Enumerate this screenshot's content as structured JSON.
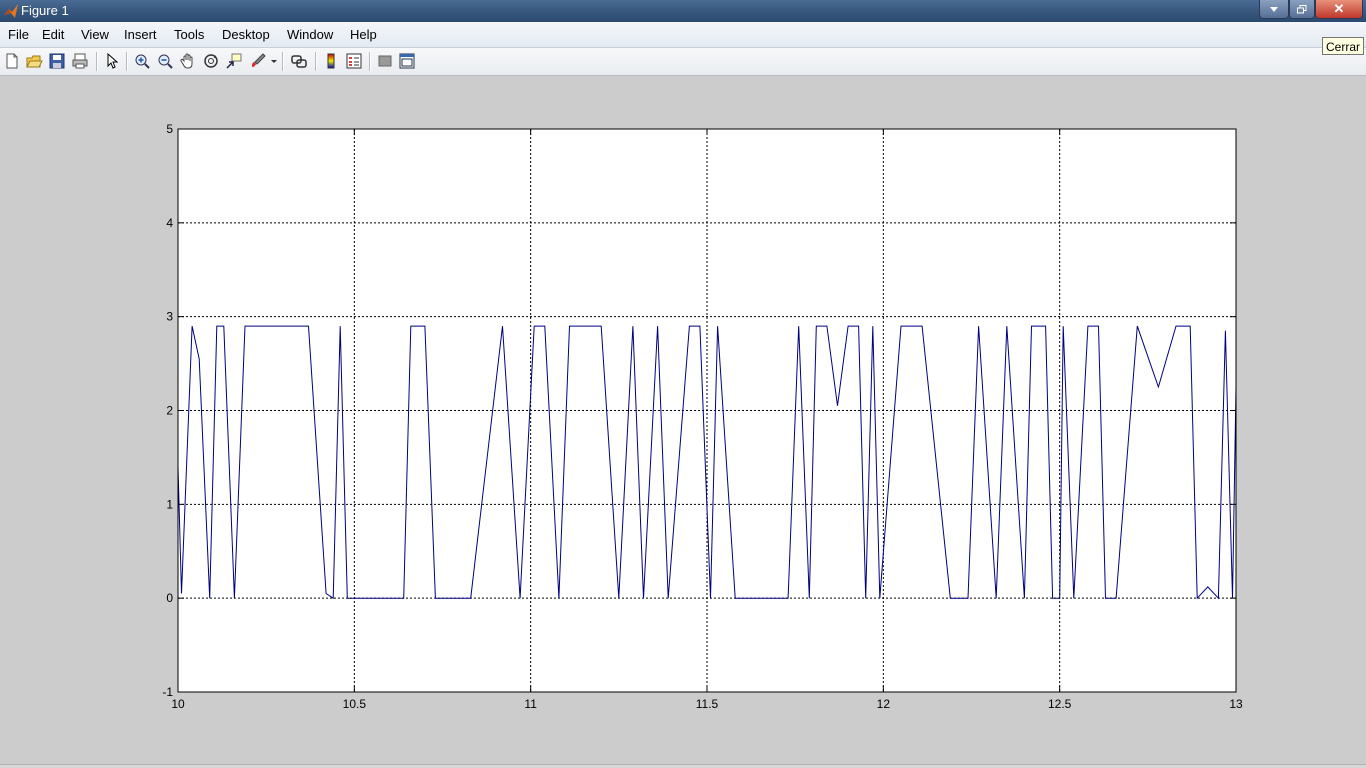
{
  "window": {
    "title": "Figure 1",
    "close_tooltip": "Cerrar"
  },
  "menu": [
    "File",
    "Edit",
    "View",
    "Insert",
    "Tools",
    "Desktop",
    "Window",
    "Help"
  ],
  "toolbar": [
    {
      "name": "new-figure-icon"
    },
    {
      "name": "open-file-icon"
    },
    {
      "name": "save-icon"
    },
    {
      "name": "print-icon"
    },
    {
      "name": "edit-plot-arrow-icon"
    },
    {
      "name": "zoom-in-icon"
    },
    {
      "name": "zoom-out-icon"
    },
    {
      "name": "pan-hand-icon"
    },
    {
      "name": "rotate-3d-icon"
    },
    {
      "name": "data-cursor-icon"
    },
    {
      "name": "brush-icon"
    },
    {
      "name": "link-plot-icon"
    },
    {
      "name": "insert-colorbar-icon"
    },
    {
      "name": "insert-legend-icon"
    },
    {
      "name": "hide-plot-tools-icon"
    },
    {
      "name": "show-plot-tools-icon"
    }
  ],
  "colors": {
    "line": "#000080",
    "grid": "#000000",
    "axes_bg": "#ffffff",
    "figure_bg": "#cccccc"
  },
  "chart_data": {
    "type": "line",
    "xlim": [
      10,
      13
    ],
    "ylim": [
      -1,
      5
    ],
    "xticks": [
      "10",
      "10.5",
      "11",
      "11.5",
      "12",
      "12.5",
      "13"
    ],
    "yticks": [
      "-1",
      "0",
      "1",
      "2",
      "3",
      "4",
      "5"
    ],
    "grid": true,
    "series": [
      {
        "x": [
          10.0,
          10.01,
          10.04,
          10.06,
          10.09,
          10.11,
          10.13,
          10.16,
          10.19,
          10.24,
          10.3,
          10.37,
          10.42,
          10.44,
          10.46,
          10.48,
          10.5,
          10.64,
          10.66,
          10.7,
          10.73,
          10.83,
          10.92,
          10.97,
          11.01,
          11.04,
          11.08,
          11.11,
          11.2,
          11.25,
          11.29,
          11.32,
          11.36,
          11.39,
          11.45,
          11.48,
          11.51,
          11.53,
          11.58,
          11.73,
          11.76,
          11.79,
          11.81,
          11.84,
          11.87,
          11.9,
          11.93,
          11.95,
          11.97,
          11.99,
          12.05,
          12.07,
          12.11,
          12.19,
          12.24,
          12.27,
          12.32,
          12.35,
          12.4,
          12.42,
          12.46,
          12.48,
          12.5,
          12.51,
          12.54,
          12.58,
          12.61,
          12.63,
          12.66,
          12.72,
          12.78,
          12.83,
          12.87,
          12.89,
          12.92,
          12.95,
          12.97,
          12.99,
          13.0
        ],
        "y": [
          1.4,
          0.05,
          2.9,
          2.55,
          0.0,
          2.9,
          2.9,
          0.0,
          2.9,
          2.9,
          2.9,
          2.9,
          0.05,
          0.0,
          2.9,
          0.0,
          0.0,
          0.0,
          2.9,
          2.9,
          0.0,
          0.0,
          2.9,
          0.0,
          2.9,
          2.9,
          0.0,
          2.9,
          2.9,
          0.0,
          2.9,
          0.0,
          2.9,
          0.0,
          2.9,
          2.9,
          0.0,
          2.9,
          0.0,
          0.0,
          2.9,
          0.0,
          2.9,
          2.9,
          2.05,
          2.9,
          2.9,
          0.0,
          2.9,
          0.0,
          2.9,
          2.9,
          2.9,
          0.0,
          0.0,
          2.9,
          0.0,
          2.9,
          0.0,
          2.9,
          2.9,
          0.0,
          0.0,
          2.9,
          0.0,
          2.9,
          2.9,
          0.0,
          0.0,
          2.9,
          2.25,
          2.9,
          2.9,
          0.0,
          0.12,
          0.0,
          2.85,
          0.0,
          2.25
        ]
      }
    ]
  }
}
